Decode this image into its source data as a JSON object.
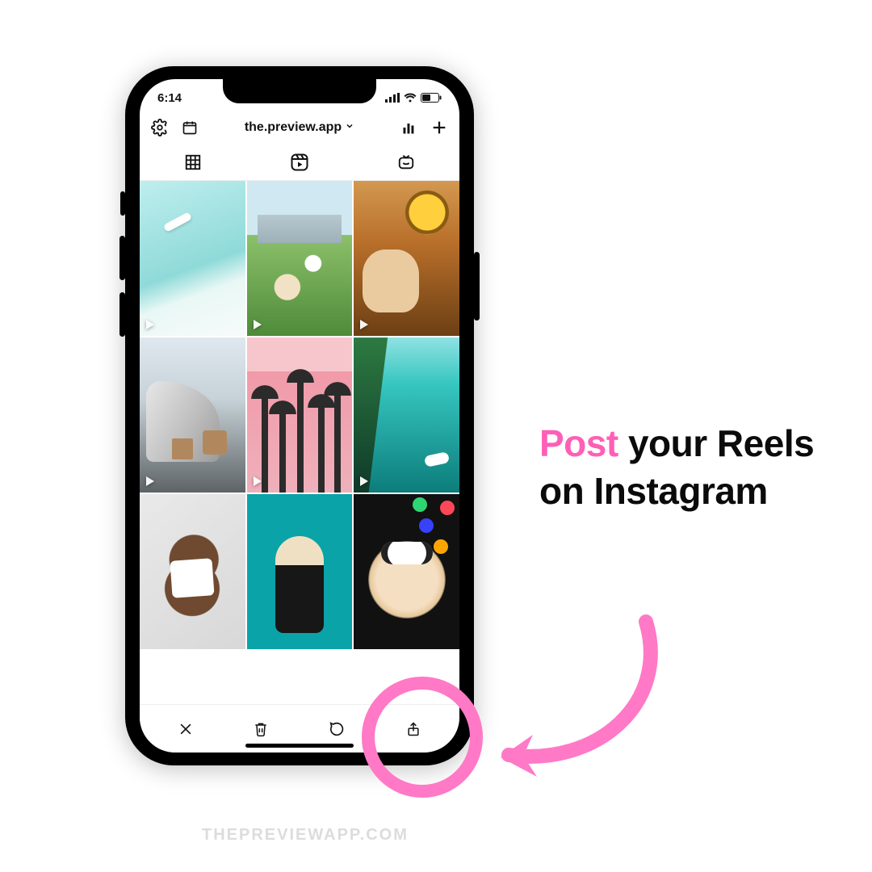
{
  "status": {
    "time": "6:14"
  },
  "header": {
    "username": "the.preview.app",
    "icons": {
      "settings": "gear-icon",
      "calendar": "calendar-icon",
      "analytics": "analytics-icon",
      "add": "plus-icon"
    }
  },
  "tabs": {
    "grid": "grid-icon",
    "reels": "reel-icon",
    "igtv": "igtv-icon",
    "active": "reels"
  },
  "bottomBar": {
    "close": "close-icon",
    "trash": "trash-icon",
    "comment": "comment-icon",
    "share": "share-icon"
  },
  "caption": {
    "highlight": "Post",
    "rest": " your Reels on Instagram"
  },
  "highlightColor": "#ff79c6",
  "watermark": "THEPREVIEWAPP.COM"
}
